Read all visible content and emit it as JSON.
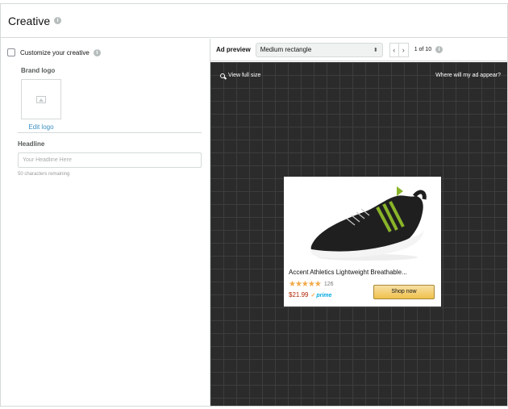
{
  "header": {
    "title": "Creative"
  },
  "left": {
    "customize_label": "Customize your creative",
    "brand_logo_label": "Brand logo",
    "edit_logo_label": "Edit logo",
    "headline_label": "Headline",
    "headline_placeholder": "Your Headline Here",
    "headline_value": "",
    "remaining_text": "50 characters remaining"
  },
  "toolbar": {
    "ad_preview_label": "Ad preview",
    "size_selected": "Medium rectangle",
    "prev_glyph": "‹",
    "next_glyph": "›",
    "page_count": "1 of 10"
  },
  "canvas": {
    "view_full_label": "View full size",
    "where_label": "Where will my ad appear?"
  },
  "ad": {
    "title": "Accent Athletics Lightweight Breathable...",
    "rating_stars": "★★★★★",
    "rating": 4.5,
    "review_count": "126",
    "price": "$21.99",
    "prime_check": "✓",
    "prime_text": "prime",
    "shop_label": "Shop now"
  },
  "colors": {
    "link": "#3b8fc2",
    "canvas_bg": "#2b2b2b",
    "star": "#f3a847",
    "price": "#b12704",
    "prime": "#00a8e1",
    "button": "#f0c14b"
  },
  "icons": [
    "info-icon",
    "image-placeholder-icon",
    "search-icon",
    "chevron-left-icon",
    "chevron-right-icon",
    "select-arrows-icon"
  ]
}
